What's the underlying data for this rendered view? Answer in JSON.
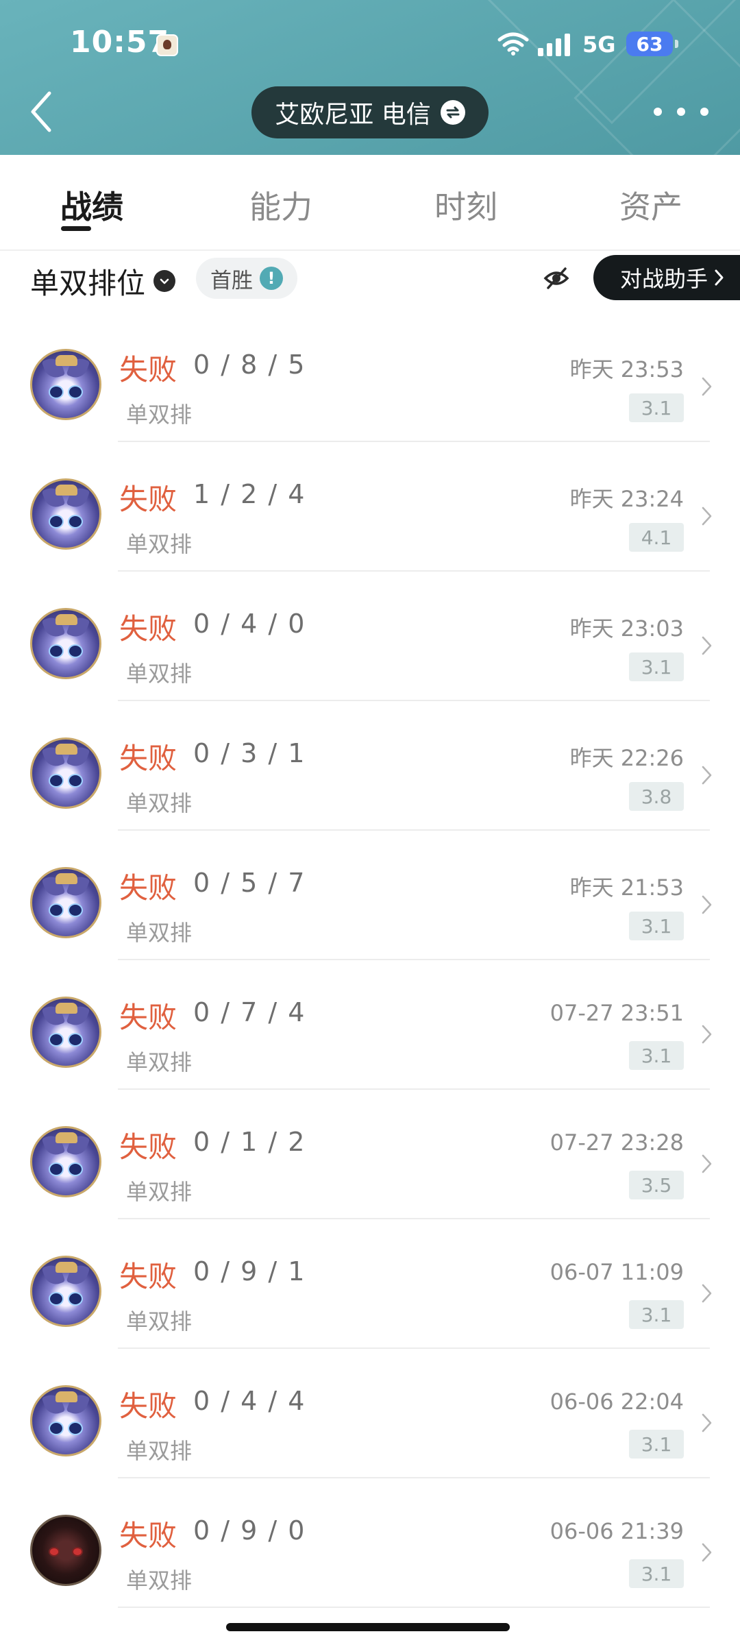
{
  "status_bar": {
    "time": "10:57",
    "network": "5G",
    "battery": "63"
  },
  "header": {
    "server_label": "艾欧尼亚 电信"
  },
  "tabs": [
    {
      "label": "战绩"
    },
    {
      "label": "能力"
    },
    {
      "label": "时刻"
    },
    {
      "label": "资产"
    }
  ],
  "filter": {
    "mode": "单双排位",
    "first_win": "首胜",
    "assistant": "对战助手"
  },
  "matches": [
    {
      "result": "失败",
      "kda": "0 / 8 / 5",
      "queue": "单双排",
      "time": "昨天 23:53",
      "score": "3.1"
    },
    {
      "result": "失败",
      "kda": "1 / 2 / 4",
      "queue": "单双排",
      "time": "昨天 23:24",
      "score": "4.1"
    },
    {
      "result": "失败",
      "kda": "0 / 4 / 0",
      "queue": "单双排",
      "time": "昨天 23:03",
      "score": "3.1"
    },
    {
      "result": "失败",
      "kda": "0 / 3 / 1",
      "queue": "单双排",
      "time": "昨天 22:26",
      "score": "3.8"
    },
    {
      "result": "失败",
      "kda": "0 / 5 / 7",
      "queue": "单双排",
      "time": "昨天 21:53",
      "score": "3.1"
    },
    {
      "result": "失败",
      "kda": "0 / 7 / 4",
      "queue": "单双排",
      "time": "07-27 23:51",
      "score": "3.1"
    },
    {
      "result": "失败",
      "kda": "0 / 1 / 2",
      "queue": "单双排",
      "time": "07-27 23:28",
      "score": "3.5"
    },
    {
      "result": "失败",
      "kda": "0 / 9 / 1",
      "queue": "单双排",
      "time": "06-07 11:09",
      "score": "3.1"
    },
    {
      "result": "失败",
      "kda": "0 / 4 / 4",
      "queue": "单双排",
      "time": "06-06 22:04",
      "score": "3.1"
    },
    {
      "result": "失败",
      "kda": "0 / 9 / 0",
      "queue": "单双排",
      "time": "06-06 21:39",
      "score": "3.1"
    }
  ],
  "colors": {
    "header_bg": "#5aa7b0",
    "loss_text": "#e0603f",
    "pill_dark": "#24393b"
  }
}
